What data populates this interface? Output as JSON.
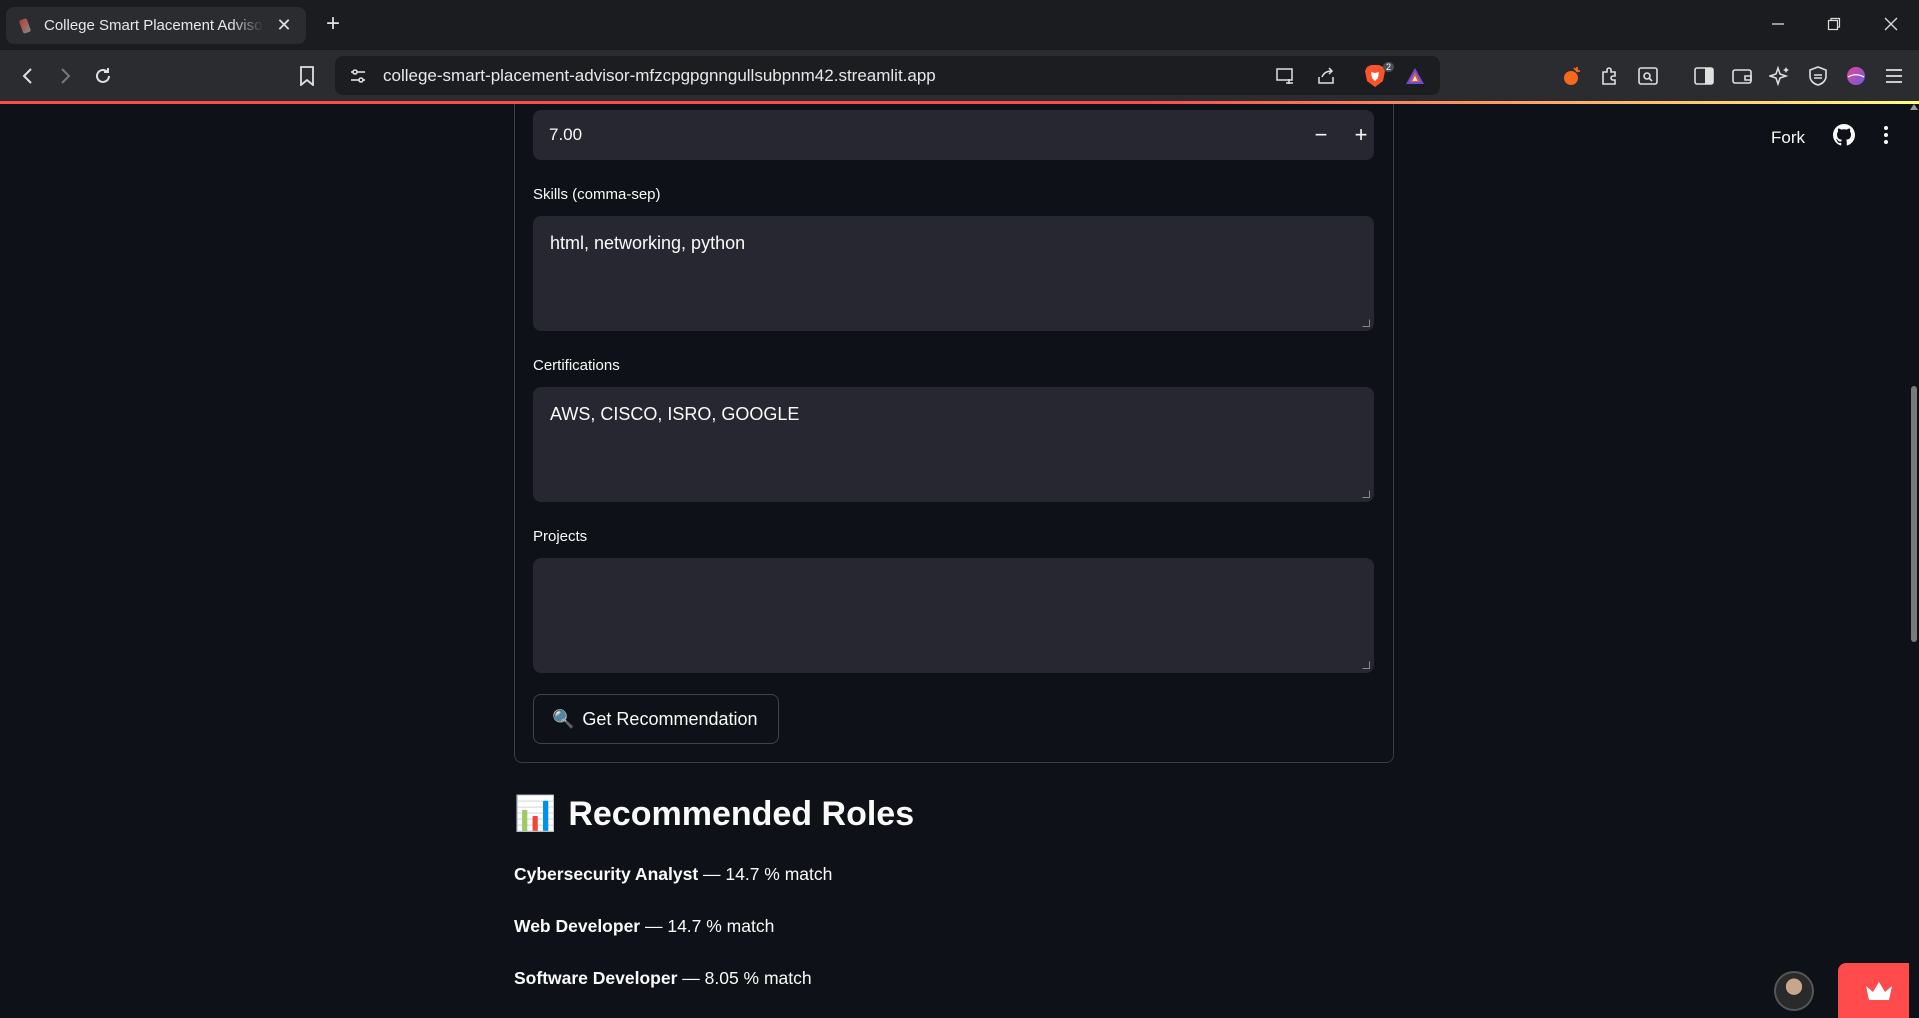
{
  "browser": {
    "tab_title": "College Smart Placement Advisor",
    "tab_close": "✕",
    "new_tab": "+",
    "url": "college-smart-placement-advisor-mfzcpgpgnngullsubpnm42.streamlit.app",
    "brave_badge_count": "2"
  },
  "header": {
    "fork_label": "Fork"
  },
  "form": {
    "number_value": "7.00",
    "minus": "−",
    "plus": "+",
    "skills_label": "Skills (comma-sep)",
    "skills_value": "html, networking, python",
    "certs_label": "Certifications",
    "certs_value": "AWS, CISCO, ISRO, GOOGLE",
    "projects_label": "Projects",
    "projects_value": "",
    "button_icon": "🔍",
    "button_label": "Get Recommendation"
  },
  "results": {
    "title_icon": "📊",
    "title": "Recommended Roles",
    "roles": [
      {
        "name": "Cybersecurity Analyst",
        "detail": " — 14.7 % match"
      },
      {
        "name": "Web Developer",
        "detail": " — 14.7 % match"
      },
      {
        "name": "Software Developer",
        "detail": " — 8.05 % match"
      }
    ]
  },
  "colors": {
    "background": "#0e1117",
    "input_bg": "#262730",
    "accent": "#ff4b4b"
  }
}
